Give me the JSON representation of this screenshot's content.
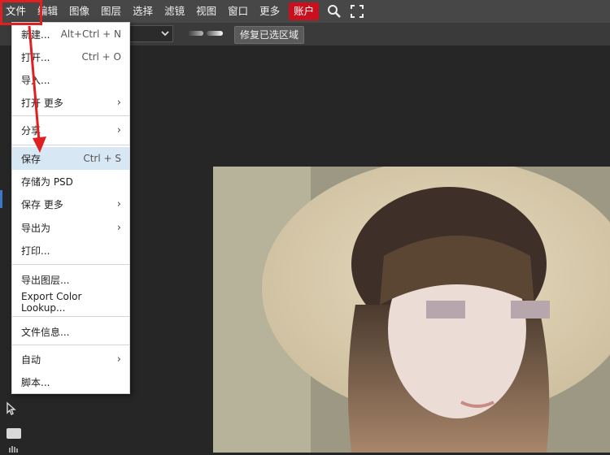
{
  "menubar": {
    "items": [
      "文件",
      "编辑",
      "图像",
      "图层",
      "选择",
      "滤镜",
      "视图",
      "窗口",
      "更多"
    ],
    "account": "账户",
    "icons": [
      "search-icon",
      "fullscreen-icon"
    ]
  },
  "options": {
    "repair_button": "修复已选区域"
  },
  "file_menu": {
    "items": [
      {
        "label": "新建...",
        "shortcut": "Alt+Ctrl + N"
      },
      {
        "label": "打开...",
        "shortcut": "Ctrl + O"
      },
      {
        "label": "导入...",
        "shortcut": ""
      },
      {
        "label": "打开 更多",
        "shortcut": ""
      },
      {
        "label": "分享",
        "shortcut": ""
      },
      {
        "label": "保存",
        "shortcut": "Ctrl + S"
      },
      {
        "label": "存储为 PSD",
        "shortcut": ""
      },
      {
        "label": "保存 更多",
        "shortcut": ""
      },
      {
        "label": "导出为",
        "shortcut": ""
      },
      {
        "label": "打印...",
        "shortcut": ""
      },
      {
        "label": "导出图层...",
        "shortcut": ""
      },
      {
        "label": "Export Color Lookup...",
        "shortcut": ""
      },
      {
        "label": "文件信息...",
        "shortcut": ""
      },
      {
        "label": "自动",
        "shortcut": ""
      },
      {
        "label": "脚本...",
        "shortcut": ""
      }
    ],
    "highlighted": "保存"
  },
  "colors": {
    "menubar_bg": "#474747",
    "workspace_bg": "#262626",
    "account_red": "#c8101e",
    "menu_highlight": "#d8e7f4",
    "annotation_red": "#e02020"
  }
}
